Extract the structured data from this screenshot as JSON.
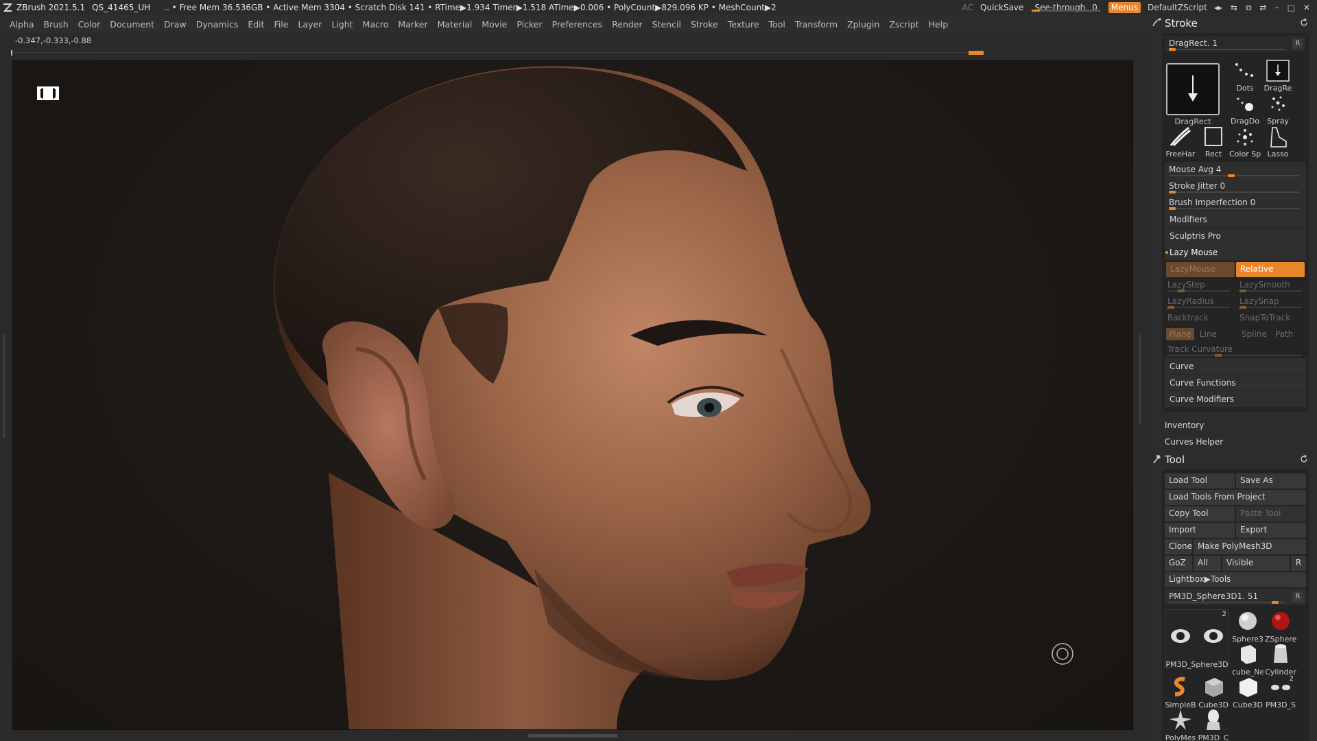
{
  "titlebar": {
    "app": "ZBrush 2021.5.1",
    "project": "QS_41465_UH",
    "status": ".. • Free Mem 36.536GB • Active Mem 3304 • Scratch Disk 141 • RTime▶1.934 Timer▶1.518 ATime▶0.006 • PolyCount▶829.096 KP • MeshCount▶2",
    "ac": "AC",
    "quicksave": "QuickSave",
    "see_through_label": "See-through",
    "see_through_value": "0",
    "menus": "Menus",
    "script": "DefaultZScript"
  },
  "menubar": [
    "Alpha",
    "Brush",
    "Color",
    "Document",
    "Draw",
    "Dynamics",
    "Edit",
    "File",
    "Layer",
    "Light",
    "Macro",
    "Marker",
    "Material",
    "Movie",
    "Picker",
    "Preferences",
    "Render",
    "Stencil",
    "Stroke",
    "Texture",
    "Tool",
    "Transform",
    "Zplugin",
    "Zscript",
    "Help"
  ],
  "coords": "-0.347,-0.333,-0.88",
  "stroke_panel": {
    "title": "Stroke",
    "current": "DragRect. 1",
    "r_btn": "R",
    "big_label": "DragRect",
    "icons": [
      "Dots",
      "DragRe",
      "DragDo",
      "Spray",
      "FreeHar",
      "Rect",
      "Color Sp",
      "Lasso"
    ],
    "mouse_avg": "Mouse Avg 4",
    "mouse_avg_value": 4,
    "stroke_jitter": "Stroke Jitter 0",
    "brush_imperfection": "Brush Imperfection 0",
    "modifiers": "Modifiers",
    "sculptris_pro": "Sculptris Pro",
    "lazy_mouse": "Lazy Mouse",
    "lazymouse_btn": "LazyMouse",
    "relative_btn": "Relative",
    "lazystep": "LazyStep",
    "lazysmooth": "LazySmooth",
    "lazyradius": "LazyRadius",
    "lazysnap": "LazySnap",
    "backtrack": "Backtrack",
    "snaptotrack": "SnapToTrack",
    "modes": [
      "Plane",
      "Line",
      "Spline",
      "Path"
    ],
    "track_curvature": "Track Curvature",
    "curve": "Curve",
    "curve_functions": "Curve Functions",
    "curve_modifiers": "Curve Modifiers"
  },
  "inventory": "Inventory",
  "curves_helper": "Curves Helper",
  "tool_panel": {
    "title": "Tool",
    "load_tool": "Load Tool",
    "save_as": "Save As",
    "load_from_project": "Load Tools From Project",
    "copy_tool": "Copy Tool",
    "paste_tool": "Paste Tool",
    "import": "Import",
    "export": "Export",
    "clone": "Clone",
    "make_polymesh": "Make PolyMesh3D",
    "goz": "GoZ",
    "all": "All",
    "visible": "Visible",
    "r_btn": "R",
    "lightbox_tools": "Lightbox▶Tools",
    "current_tool": "PM3D_Sphere3D1. 51",
    "main_tile_label": "PM3D_Sphere3D",
    "main_tile_count": "2",
    "tiles": [
      "Sphere3",
      "ZSphere",
      "cube_Ne",
      "Cylinder",
      "SimpleB",
      "Cube3D",
      "Cube3D",
      "PM3D_S",
      "PolyMes",
      "PM3D_C"
    ],
    "small_tile_count": "2"
  },
  "colors": {
    "accent": "#e8862c",
    "background": "#2a2a2a",
    "viewport_bg": "#1c1815"
  }
}
